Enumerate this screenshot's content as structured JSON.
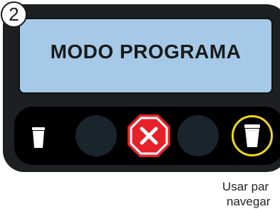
{
  "step_number": "2",
  "screen": {
    "title": "MODO PROGRAMA"
  },
  "buttons": {
    "small_cup_icon": "small-cup-icon",
    "cancel_icon": "cancel-x-icon",
    "large_cup_icon": "large-cup-icon",
    "highlighted": "large-cup-button"
  },
  "instruction": {
    "line1": "Usar par",
    "line2": "navegar"
  },
  "colors": {
    "device_body": "#1d1f20",
    "screen": "#a5c9e7",
    "round_button": "#19242c",
    "cancel_red": "#e8202a",
    "highlight_ring": "#f0d81d"
  }
}
